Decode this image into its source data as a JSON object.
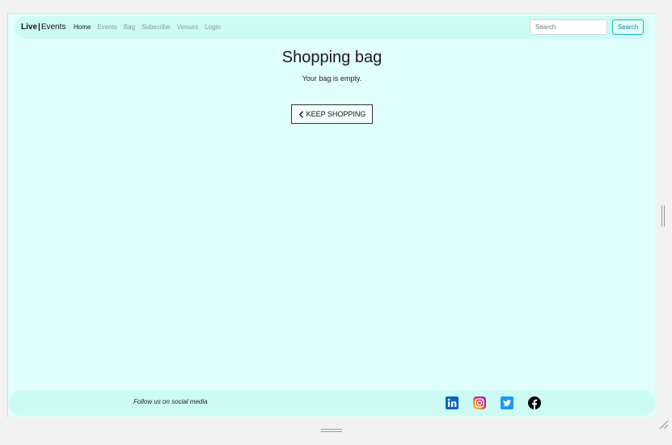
{
  "navbar": {
    "brand_live": "Live",
    "brand_separator": "|",
    "brand_events": "Events",
    "links": [
      {
        "label": "Home",
        "active": true
      },
      {
        "label": "Events",
        "active": false
      },
      {
        "label": "Bag",
        "active": false
      },
      {
        "label": "Subscribe",
        "active": false
      },
      {
        "label": "Venues",
        "active": false
      },
      {
        "label": "Login",
        "active": false
      }
    ],
    "search_placeholder": "Search",
    "search_button": "Search"
  },
  "main": {
    "title": "Shopping bag",
    "empty_message": "Your bag is empty.",
    "keep_shopping_label": "KEEP SHOPPING"
  },
  "footer": {
    "follow_text": "Follow us on social media",
    "social": [
      {
        "icon": "linkedin-icon",
        "color": "#0a66c2"
      },
      {
        "icon": "instagram-icon",
        "color": "#e1306c"
      },
      {
        "icon": "twitter-icon",
        "color": "#1d9bf0"
      },
      {
        "icon": "facebook-icon",
        "color": "#000000"
      }
    ]
  },
  "colors": {
    "page_background": "#e0fefb",
    "bar_background": "#ccfbf5",
    "accent": "#17b5c4"
  }
}
